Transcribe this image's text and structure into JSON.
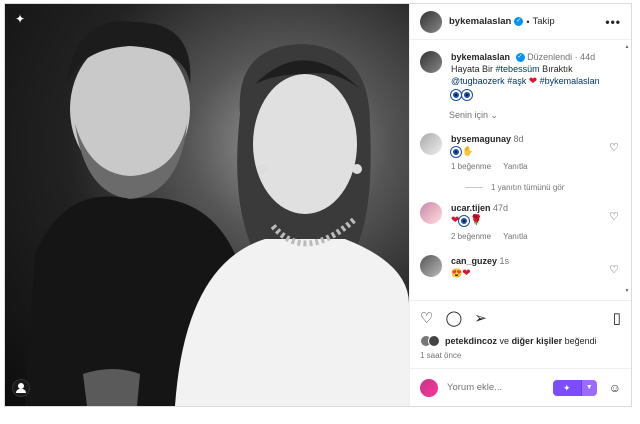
{
  "post": {
    "username": "bykemalaslan",
    "follow_label": "Takip",
    "more_label": "•••"
  },
  "caption": {
    "username": "bykemalaslan",
    "edited_label": "Düzenlendi",
    "age": "44d",
    "text_prefix": "Hayata Bir",
    "hashtag1": "#tebessüm",
    "text_mid": "Bıraktık",
    "mention": "@tugbaozerk",
    "hashtag2": "#aşk",
    "hashtag3": "#bykemalaslan"
  },
  "for_you_label": "Senin için",
  "comments": [
    {
      "username": "bysemagunay",
      "age": "8d",
      "likes": "1 beğenme",
      "reply_label": "Yanıtla"
    },
    {
      "username": "ucar.tijen",
      "age": "47d",
      "likes": "2 beğenme",
      "reply_label": "Yanıtla"
    },
    {
      "username": "can_guzey",
      "age": "1s"
    }
  ],
  "view_replies_label": "1 yanıtın tümünü gör",
  "likes": {
    "user": "petekdincoz",
    "connector": "ve",
    "others": "diğer kişiler",
    "suffix": "beğendi"
  },
  "timestamp": "1 saat önce",
  "add_comment": {
    "placeholder": "Yorum ekle..."
  },
  "icons": {
    "like": "heart-outline-icon",
    "comment": "comment-icon",
    "share": "share-icon",
    "save": "bookmark-icon"
  },
  "colors": {
    "verified": "#0095f6",
    "link": "#00376b",
    "ai_button": "#7c4dff"
  }
}
